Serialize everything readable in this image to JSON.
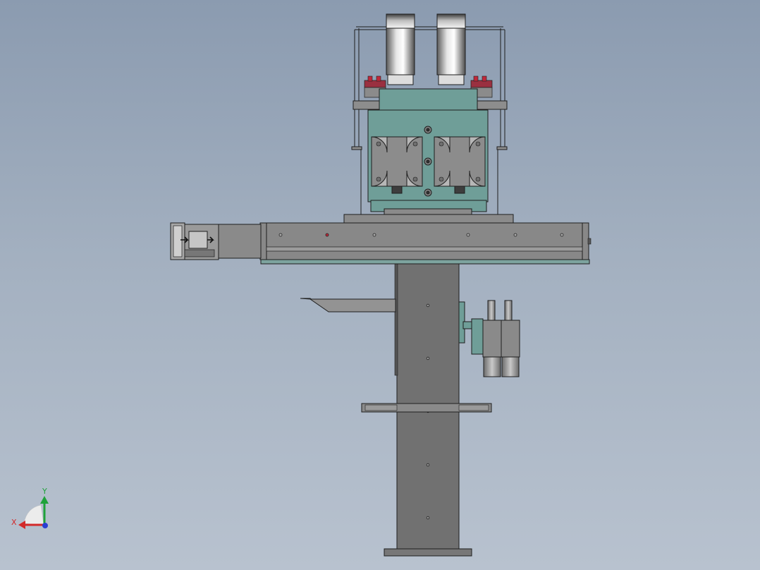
{
  "viewport": {
    "background_top": "#8b9bb0",
    "background_bottom": "#b8c2cf"
  },
  "colors": {
    "metal_dark": "#6f6f6f",
    "metal_mid": "#8a8a8a",
    "metal_light": "#9a9a9a",
    "teal_plate": "#6f9e98",
    "teal_dark": "#4f807a",
    "outline": "#1e1e1e",
    "fastener_red": "#c0283a"
  },
  "triad": {
    "x_label": "X",
    "y_label": "Y",
    "x_color": "#d22a2a",
    "y_color": "#1fa23a",
    "z_color": "#2a3fd2"
  }
}
